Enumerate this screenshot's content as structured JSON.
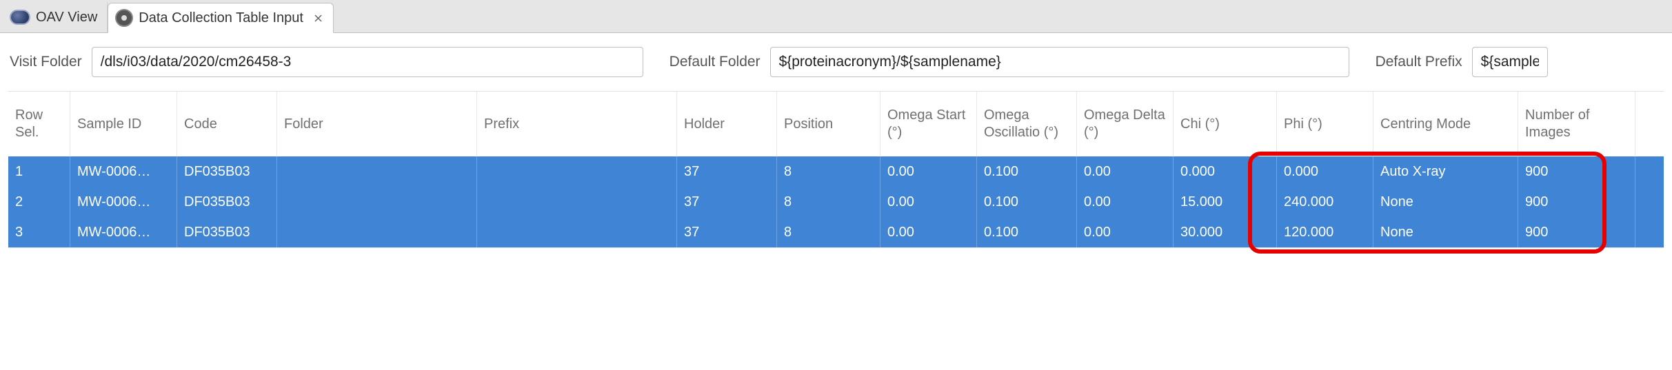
{
  "tabs": {
    "oav": {
      "label": "OAV View"
    },
    "dc": {
      "label": "Data Collection Table Input",
      "close_glyph": "⨯"
    }
  },
  "toolbar": {
    "visit_label": "Visit Folder",
    "visit_value": "/dls/i03/data/2020/cm26458-3",
    "folder_label": "Default Folder",
    "folder_value": "${proteinacronym}/${samplename}",
    "prefix_label": "Default Prefix",
    "prefix_value": "${sample"
  },
  "columns": {
    "row_sel": "Row Sel.",
    "sample_id": "Sample ID",
    "code": "Code",
    "folder": "Folder",
    "prefix": "Prefix",
    "holder": "Holder",
    "position": "Position",
    "omega_s": "Omega Start (°)",
    "omega_o": "Omega Oscillatio (°)",
    "omega_d": "Omega Delta (°)",
    "chi": "Chi (°)",
    "phi": "Phi (°)",
    "centring": "Centring Mode",
    "nimages": "Number of Images"
  },
  "rows": [
    {
      "row": "1",
      "sample_id": "MW-0006…",
      "code": "DF035B03",
      "folder": "",
      "prefix": "",
      "holder": "37",
      "position": "8",
      "omega_s": "0.00",
      "omega_o": "0.100",
      "omega_d": "0.00",
      "chi": "0.000",
      "phi": "0.000",
      "centring": "Auto X-ray",
      "nimages": "900"
    },
    {
      "row": "2",
      "sample_id": "MW-0006…",
      "code": "DF035B03",
      "folder": "",
      "prefix": "",
      "holder": "37",
      "position": "8",
      "omega_s": "0.00",
      "omega_o": "0.100",
      "omega_d": "0.00",
      "chi": "15.000",
      "phi": "240.000",
      "centring": "None",
      "nimages": "900"
    },
    {
      "row": "3",
      "sample_id": "MW-0006…",
      "code": "DF035B03",
      "folder": "",
      "prefix": "",
      "holder": "37",
      "position": "8",
      "omega_s": "0.00",
      "omega_o": "0.100",
      "omega_d": "0.00",
      "chi": "30.000",
      "phi": "120.000",
      "centring": "None",
      "nimages": "900"
    }
  ]
}
